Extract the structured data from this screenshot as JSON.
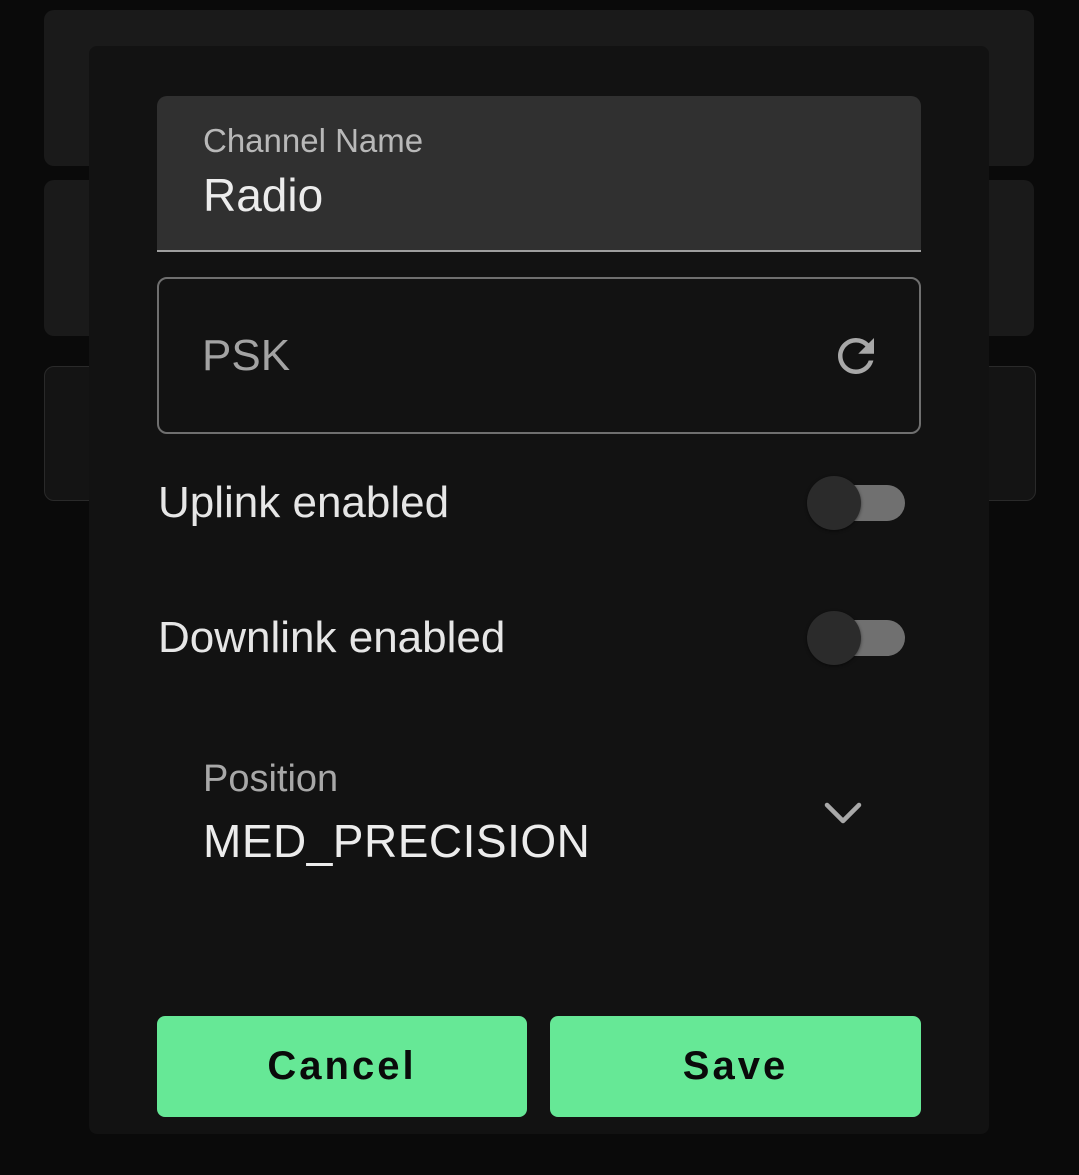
{
  "dialog": {
    "channel_name": {
      "label": "Channel Name",
      "value": "Radio"
    },
    "psk": {
      "placeholder": "PSK",
      "icon": "refresh-icon"
    },
    "uplink": {
      "label": "Uplink enabled",
      "enabled": false
    },
    "downlink": {
      "label": "Downlink enabled",
      "enabled": false
    },
    "position": {
      "label": "Position",
      "value": "MED_PRECISION",
      "icon": "chevron-down-icon"
    },
    "buttons": {
      "cancel": "Cancel",
      "save": "Save"
    }
  },
  "colors": {
    "accent": "#66e896",
    "background": "#121212",
    "field_fill": "#303030"
  }
}
